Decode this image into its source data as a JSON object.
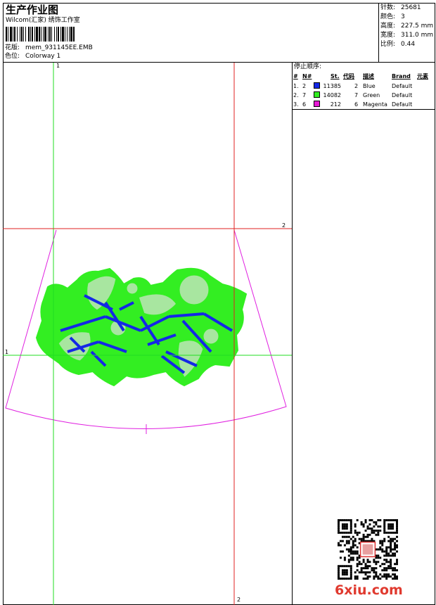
{
  "header": {
    "title": "生产作业图",
    "company": "Wilcom(汇家) 绣饰工作室",
    "design_label": "花版:",
    "design_value": "mem_931145EE.EMB",
    "colorway_label": "色位:",
    "colorway_value": "Colorway 1"
  },
  "stats": [
    {
      "label": "针数:",
      "value": "25681"
    },
    {
      "label": "颜色:",
      "value": "3"
    },
    {
      "label": "高度:",
      "value": "227.5 mm"
    },
    {
      "label": "宽度:",
      "value": "311.0 mm"
    },
    {
      "label": "比例:",
      "value": "0.44"
    }
  ],
  "stop_sequence": {
    "title": "停止顺序:",
    "columns": [
      "#",
      "N#",
      "St.",
      "代码",
      "描述",
      "Brand",
      "元素"
    ],
    "rows": [
      {
        "num": "1.",
        "needle": "2",
        "stitches": "11385",
        "code": "2",
        "desc": "Blue",
        "brand": "Default",
        "color": "#1428e6"
      },
      {
        "num": "2.",
        "needle": "7",
        "stitches": "14082",
        "code": "7",
        "desc": "Green",
        "brand": "Default",
        "color": "#33ee22"
      },
      {
        "num": "3.",
        "needle": "6",
        "stitches": "212",
        "code": "6",
        "desc": "Magenta",
        "brand": "Default",
        "color": "#e619d4"
      }
    ]
  },
  "guides": {
    "v1": "1",
    "v2": "2",
    "h1": "1",
    "h2": "2"
  },
  "watermark": {
    "text": "6xiu.com"
  },
  "colors": {
    "guide_green": "#22dd22",
    "guide_red": "#e02020",
    "hoop_magenta": "#e020e0",
    "fill_green": "#33ee22",
    "fill_blue": "#1428e6"
  }
}
